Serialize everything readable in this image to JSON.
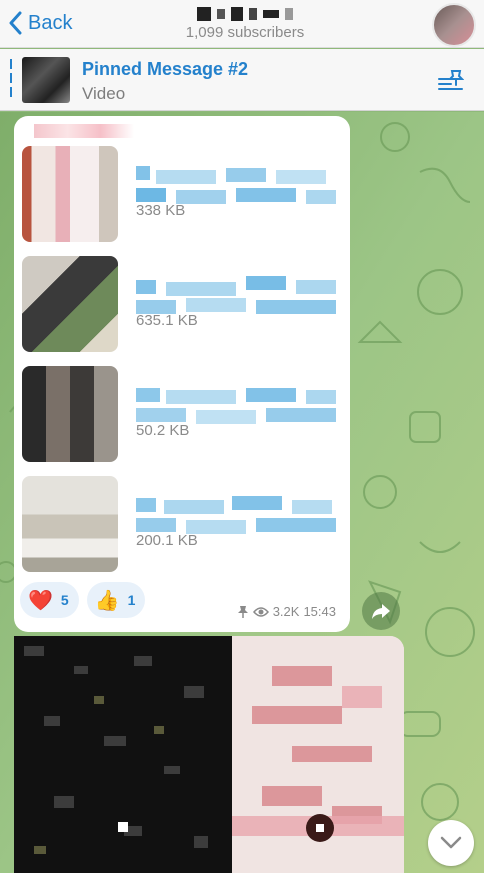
{
  "header": {
    "back_label": "Back",
    "subscribers": "1,099 subscribers"
  },
  "pinned": {
    "title": "Pinned Message #2",
    "subtitle": "Video"
  },
  "files": [
    {
      "size": "338 KB"
    },
    {
      "size": "635.1 KB"
    },
    {
      "size": "50.2 KB"
    },
    {
      "size": "200.1 KB"
    }
  ],
  "reactions": [
    {
      "emoji": "❤️",
      "count": "5"
    },
    {
      "emoji": "👍",
      "count": "1"
    }
  ],
  "message_meta": {
    "views": "3.2K",
    "time": "15:43"
  },
  "colors": {
    "accent": "#2481cc",
    "chat_background": "#8fb97a"
  },
  "icons": {
    "back": "chevron-left-icon",
    "pinned_list": "pinned-list-icon",
    "pin": "pin-icon",
    "views": "eye-icon",
    "share": "share-arrow-icon",
    "scroll_down": "chevron-down-icon"
  }
}
